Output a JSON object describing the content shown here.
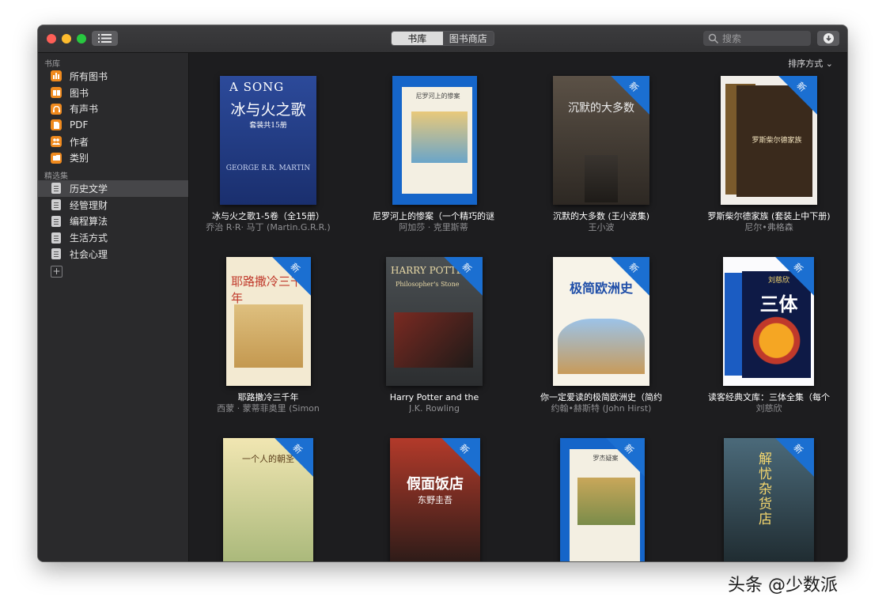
{
  "toolbar": {
    "tabs": [
      {
        "label": "书库"
      },
      {
        "label": "图书商店"
      }
    ],
    "search_placeholder": "搜索"
  },
  "sidebar": {
    "library_heading": "书库",
    "library_items": [
      {
        "label": "所有图书",
        "icon": "bar-chart-icon"
      },
      {
        "label": "图书",
        "icon": "book-icon"
      },
      {
        "label": "有声书",
        "icon": "headphones-icon"
      },
      {
        "label": "PDF",
        "icon": "pdf-icon"
      },
      {
        "label": "作者",
        "icon": "people-icon"
      },
      {
        "label": "类别",
        "icon": "folder-icon"
      }
    ],
    "collections_heading": "精选集",
    "collection_items": [
      {
        "label": "历史文学",
        "selected": true
      },
      {
        "label": "经管理财"
      },
      {
        "label": "编程算法"
      },
      {
        "label": "生活方式"
      },
      {
        "label": "社会心理"
      }
    ],
    "add_label": "+"
  },
  "main": {
    "sort_label": "排序方式",
    "new_badge": "新"
  },
  "books": [
    {
      "title": "冰与火之歌1-5卷（全15册）",
      "author": "乔治 R·R· 马丁 (Martin.G.R.R.)",
      "new": false,
      "cover_text": "A SONG",
      "cover_sub": "冰与火之歌",
      "cover_extra": "套装共15册",
      "cover_name": "GEORGE R.R. MARTIN"
    },
    {
      "title": "尼罗河上的惨案（一个精巧的谜",
      "author": "阿加莎 · 克里斯蒂",
      "new": false,
      "cover_text": "尼罗河上的惨案"
    },
    {
      "title": "沉默的大多数 (王小波集)",
      "author": "王小波",
      "new": true,
      "cover_text": "沉默的大多数"
    },
    {
      "title": "罗斯柴尔德家族 (套装上中下册)",
      "author": "尼尔•弗格森",
      "new": true,
      "cover_text": "罗斯柴尔德家族"
    },
    {
      "title": "耶路撒冷三千年",
      "author": "西蒙 · 蒙蒂菲奥里 (Simon",
      "new": true,
      "cover_text": "耶路撒冷三千年"
    },
    {
      "title": "Harry Potter and the",
      "author": "J.K. Rowling",
      "new": true,
      "cover_text": "HARRY POTTER",
      "cover_sub": "Philosopher's Stone"
    },
    {
      "title": "你一定爱读的极简欧洲史（简约",
      "author": "约翰•赫斯特 (John Hirst)",
      "new": true,
      "cover_text": "极简欧洲史"
    },
    {
      "title": "读客经典文库：三体全集（每个",
      "author": "刘慈欣",
      "new": true,
      "cover_text": "三体",
      "cover_sub": "刘慈欣"
    },
    {
      "title": "",
      "author": "",
      "new": true,
      "cover_text": "一个人的朝圣"
    },
    {
      "title": "",
      "author": "",
      "new": true,
      "cover_text": "假面饭店",
      "cover_sub": "东野圭吾"
    },
    {
      "title": "",
      "author": "",
      "new": true,
      "cover_text": "罗杰疑案"
    },
    {
      "title": "",
      "author": "",
      "new": true,
      "cover_text": "解忧杂货店"
    }
  ],
  "watermark": "头条 @少数派"
}
